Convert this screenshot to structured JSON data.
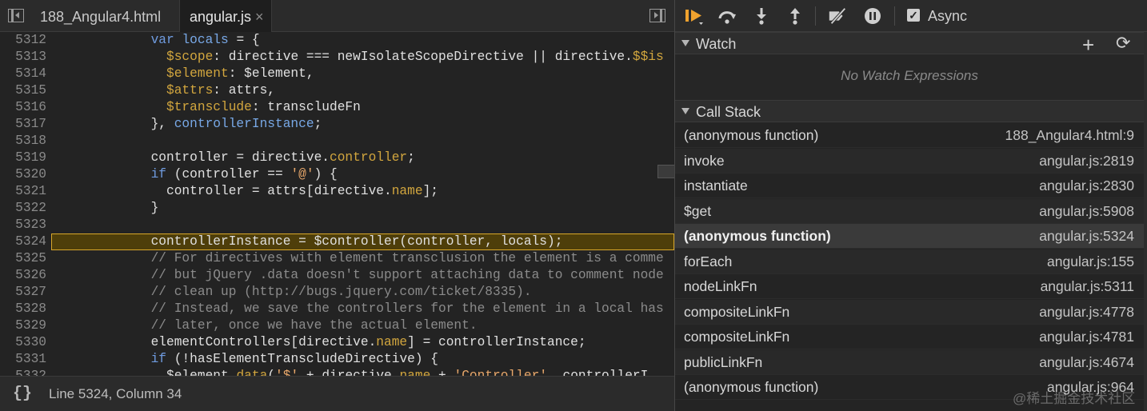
{
  "source_tabs": [
    {
      "label": "188_Angular4.html",
      "active": false
    },
    {
      "label": "angular.js",
      "active": true,
      "close_glyph": "×"
    }
  ],
  "editor": {
    "highlight_color": "#4a3a08",
    "current_line_border": "#d8a72a",
    "lines": [
      {
        "num": "5312",
        "html": "            <span class='kw'>var</span> <span class='ctl'>locals</span> = {"
      },
      {
        "num": "5313",
        "html": "              <span class='prop'>$scope</span>: directive === newIsolateScopeDirective || directive.<span class='prop'>$$is</span>"
      },
      {
        "num": "5314",
        "html": "              <span class='prop'>$element</span>: $element,"
      },
      {
        "num": "5315",
        "html": "              <span class='prop'>$attrs</span>: attrs,"
      },
      {
        "num": "5316",
        "html": "              <span class='prop'>$transclude</span>: transcludeFn"
      },
      {
        "num": "5317",
        "html": "            }, <span class='ctl'>controllerInstance</span>;"
      },
      {
        "num": "5318",
        "html": ""
      },
      {
        "num": "5319",
        "html": "            controller = directive.<span class='prop'>controller</span>;"
      },
      {
        "num": "5320",
        "html": "            <span class='kw'>if</span> (controller == <span class='str'>'@'</span>) {"
      },
      {
        "num": "5321",
        "html": "              controller = attrs[directive.<span class='prop'>name</span>];"
      },
      {
        "num": "5322",
        "html": "            }"
      },
      {
        "num": "5323",
        "html": ""
      },
      {
        "num": "5324",
        "html": "            controllerInstance = $controller(controller, locals);",
        "current": true
      },
      {
        "num": "5325",
        "html": "            <span class='cmt'>// For directives with element transclusion the element is a comme</span>"
      },
      {
        "num": "5326",
        "html": "            <span class='cmt'>// but jQuery .data doesn't support attaching data to comment node</span>"
      },
      {
        "num": "5327",
        "html": "            <span class='cmt'>// clean up (http://bugs.jquery.com/ticket/8335).</span>"
      },
      {
        "num": "5328",
        "html": "            <span class='cmt'>// Instead, we save the controllers for the element in a local has</span>"
      },
      {
        "num": "5329",
        "html": "            <span class='cmt'>// later, once we have the actual element.</span>"
      },
      {
        "num": "5330",
        "html": "            elementControllers[directive.<span class='prop'>name</span>] = controllerInstance;"
      },
      {
        "num": "5331",
        "html": "            <span class='kw'>if</span> (!hasElementTranscludeDirective) {"
      },
      {
        "num": "5332",
        "html": "              $element.<span class='prop'>data</span>(<span class='str'>'$'</span> + directive.<span class='prop'>name</span> + <span class='str'>'Controller'</span>, controllerI"
      }
    ]
  },
  "status_bar": {
    "braces": "{}",
    "cursor_position": "Line 5324, Column 34"
  },
  "debugger_toolbar": {
    "buttons": [
      "resume-icon",
      "step-over-icon",
      "step-into-icon",
      "step-out-icon",
      "deactivate-breakpoints-icon",
      "pause-on-exceptions-icon"
    ],
    "async_checked": true,
    "async_check_glyph": "✓",
    "async_label": "Async",
    "accent_color": "#f0a22e"
  },
  "watch": {
    "title": "Watch",
    "add_glyph": "+",
    "refresh_glyph": "⟳",
    "empty_text": "No Watch Expressions"
  },
  "call_stack": {
    "title": "Call Stack",
    "frames": [
      {
        "fn": "(anonymous function)",
        "loc": "188_Angular4.html:9"
      },
      {
        "fn": "invoke",
        "loc": "angular.js:2819"
      },
      {
        "fn": "instantiate",
        "loc": "angular.js:2830"
      },
      {
        "fn": "$get",
        "loc": "angular.js:5908"
      },
      {
        "fn": "(anonymous function)",
        "loc": "angular.js:5324",
        "selected": true
      },
      {
        "fn": "forEach",
        "loc": "angular.js:155"
      },
      {
        "fn": "nodeLinkFn",
        "loc": "angular.js:5311"
      },
      {
        "fn": "compositeLinkFn",
        "loc": "angular.js:4778"
      },
      {
        "fn": "compositeLinkFn",
        "loc": "angular.js:4781"
      },
      {
        "fn": "publicLinkFn",
        "loc": "angular.js:4674"
      },
      {
        "fn": "(anonymous function)",
        "loc": "angular.js:964"
      }
    ]
  },
  "watermark": "@稀土掘金技术社区"
}
